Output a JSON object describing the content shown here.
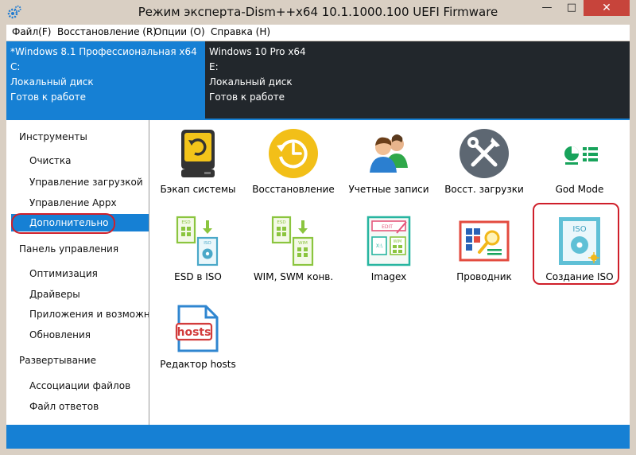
{
  "window": {
    "title": "Режим эксперта-Dism++x64 10.1.1000.100 UEFI Firmware",
    "minimize": "—",
    "maximize": "□",
    "close": "✕"
  },
  "menu": [
    "Файл(F)",
    "Восстановление (R)",
    "Опции (O)",
    "Справка (H)"
  ],
  "images": [
    {
      "name": "*Windows 8.1 Профессиональная x64",
      "drive": "C:",
      "disk": "Локальный диск",
      "status": "Готов к работе"
    },
    {
      "name": "Windows 10 Pro x64",
      "drive": "E:",
      "disk": "Локальный диск",
      "status": "Готов к работе"
    }
  ],
  "sidebar": [
    {
      "label": "Инструменты",
      "type": "header"
    },
    {
      "label": "Очистка",
      "type": "child"
    },
    {
      "label": "Управление загрузкой",
      "type": "child"
    },
    {
      "label": "Управление Appx",
      "type": "child"
    },
    {
      "label": "Дополнительно",
      "type": "selected"
    },
    {
      "label": "Панель управления",
      "type": "header"
    },
    {
      "label": "Оптимизация",
      "type": "child"
    },
    {
      "label": "Драйверы",
      "type": "child"
    },
    {
      "label": "Приложения и возможности",
      "type": "child"
    },
    {
      "label": "Обновления",
      "type": "child"
    },
    {
      "label": "Развертывание",
      "type": "header"
    },
    {
      "label": "Ассоциации файлов",
      "type": "child"
    },
    {
      "label": "Файл ответов",
      "type": "child"
    }
  ],
  "tools": [
    {
      "label": "Бэкап системы",
      "icon": "backup-drive-icon"
    },
    {
      "label": "Восстановление",
      "icon": "restore-clock-icon"
    },
    {
      "label": "Учетные записи",
      "icon": "user-accounts-icon"
    },
    {
      "label": "Восст. загрузки",
      "icon": "boot-repair-tools-icon"
    },
    {
      "label": "God Mode",
      "icon": "god-mode-icon"
    },
    {
      "label": "ESD в ISO",
      "icon": "esd-to-iso-icon",
      "badges": [
        "ESD",
        "ISO"
      ]
    },
    {
      "label": "WIM, SWM конв.",
      "icon": "wim-swm-convert-icon",
      "badges": [
        "ESD",
        "WIM"
      ]
    },
    {
      "label": "Imagex",
      "icon": "imagex-icon",
      "badges": [
        "EDIT",
        "X:\\",
        "WIM"
      ]
    },
    {
      "label": "Проводник",
      "icon": "explorer-magnifier-icon"
    },
    {
      "label": "Создание ISO",
      "icon": "create-iso-icon",
      "badges": [
        "ISO"
      ]
    },
    {
      "label": "Редактор hosts",
      "icon": "hosts-editor-icon",
      "badges": [
        "hosts"
      ]
    }
  ],
  "colors": {
    "accent": "#1680d4",
    "highlight": "#cf1f2a",
    "titlebar": "#d9cfc3",
    "close": "#c7443b"
  }
}
